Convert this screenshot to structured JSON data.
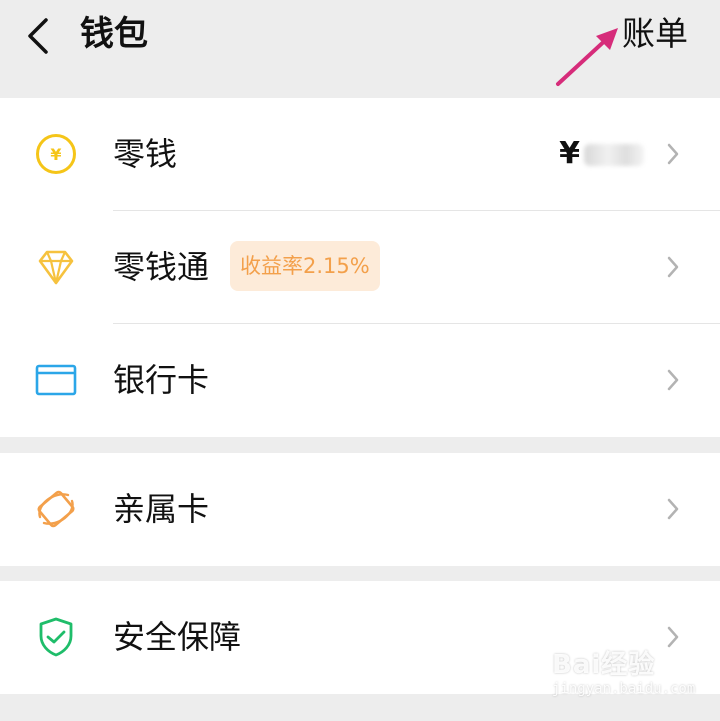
{
  "header": {
    "title": "钱包",
    "bill_label": "账单"
  },
  "menu": {
    "items": [
      {
        "label": "零钱",
        "value": "¥"
      },
      {
        "label": "零钱通",
        "badge": "收益率2.15%"
      },
      {
        "label": "银行卡"
      },
      {
        "label": "亲属卡"
      },
      {
        "label": "安全保障"
      }
    ]
  },
  "watermark": {
    "brand": "Bai经验",
    "url": "jingyan.baidu.com"
  },
  "colors": {
    "background": "#ededed",
    "arrow": "#d62c7a",
    "coin_yellow": "#f5c518",
    "diamond_yellow": "#f6c23e",
    "bank_blue": "#2ba6e8",
    "family_orange": "#f3a04b",
    "shield_green": "#1fbd6a",
    "badge_bg": "#fdebd9",
    "badge_text": "#f3a04b"
  }
}
